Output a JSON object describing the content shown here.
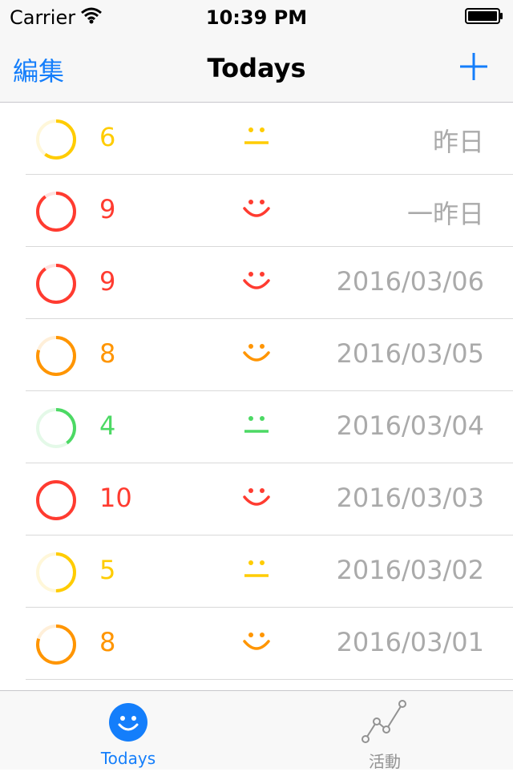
{
  "status_bar": {
    "carrier": "Carrier",
    "time": "10:39 PM"
  },
  "nav": {
    "edit_label": "編集",
    "title": "Todays"
  },
  "colors": {
    "accent": "#147efb",
    "red": "#ff3b30",
    "orange": "#ff9500",
    "yellow": "#ffcc00",
    "green": "#4cd964",
    "date_gray": "#aaaaaa"
  },
  "entries": [
    {
      "score": "6",
      "mood": "neutral",
      "color": "#ffcc00",
      "progress": 0.6,
      "date": "昨日"
    },
    {
      "score": "9",
      "mood": "happy",
      "color": "#ff3b30",
      "progress": 0.9,
      "date": "一昨日"
    },
    {
      "score": "9",
      "mood": "happy",
      "color": "#ff3b30",
      "progress": 0.9,
      "date": "2016/03/06"
    },
    {
      "score": "8",
      "mood": "happy",
      "color": "#ff9500",
      "progress": 0.8,
      "date": "2016/03/05"
    },
    {
      "score": "4",
      "mood": "neutral",
      "color": "#4cd964",
      "progress": 0.4,
      "date": "2016/03/04"
    },
    {
      "score": "10",
      "mood": "happy",
      "color": "#ff3b30",
      "progress": 1.0,
      "date": "2016/03/03"
    },
    {
      "score": "5",
      "mood": "neutral",
      "color": "#ffcc00",
      "progress": 0.5,
      "date": "2016/03/02"
    },
    {
      "score": "8",
      "mood": "happy",
      "color": "#ff9500",
      "progress": 0.8,
      "date": "2016/03/01"
    }
  ],
  "tabs": [
    {
      "label": "Todays",
      "icon": "smiley-face-icon",
      "selected": true
    },
    {
      "label": "活動",
      "icon": "activity-graph-icon",
      "selected": false
    }
  ]
}
